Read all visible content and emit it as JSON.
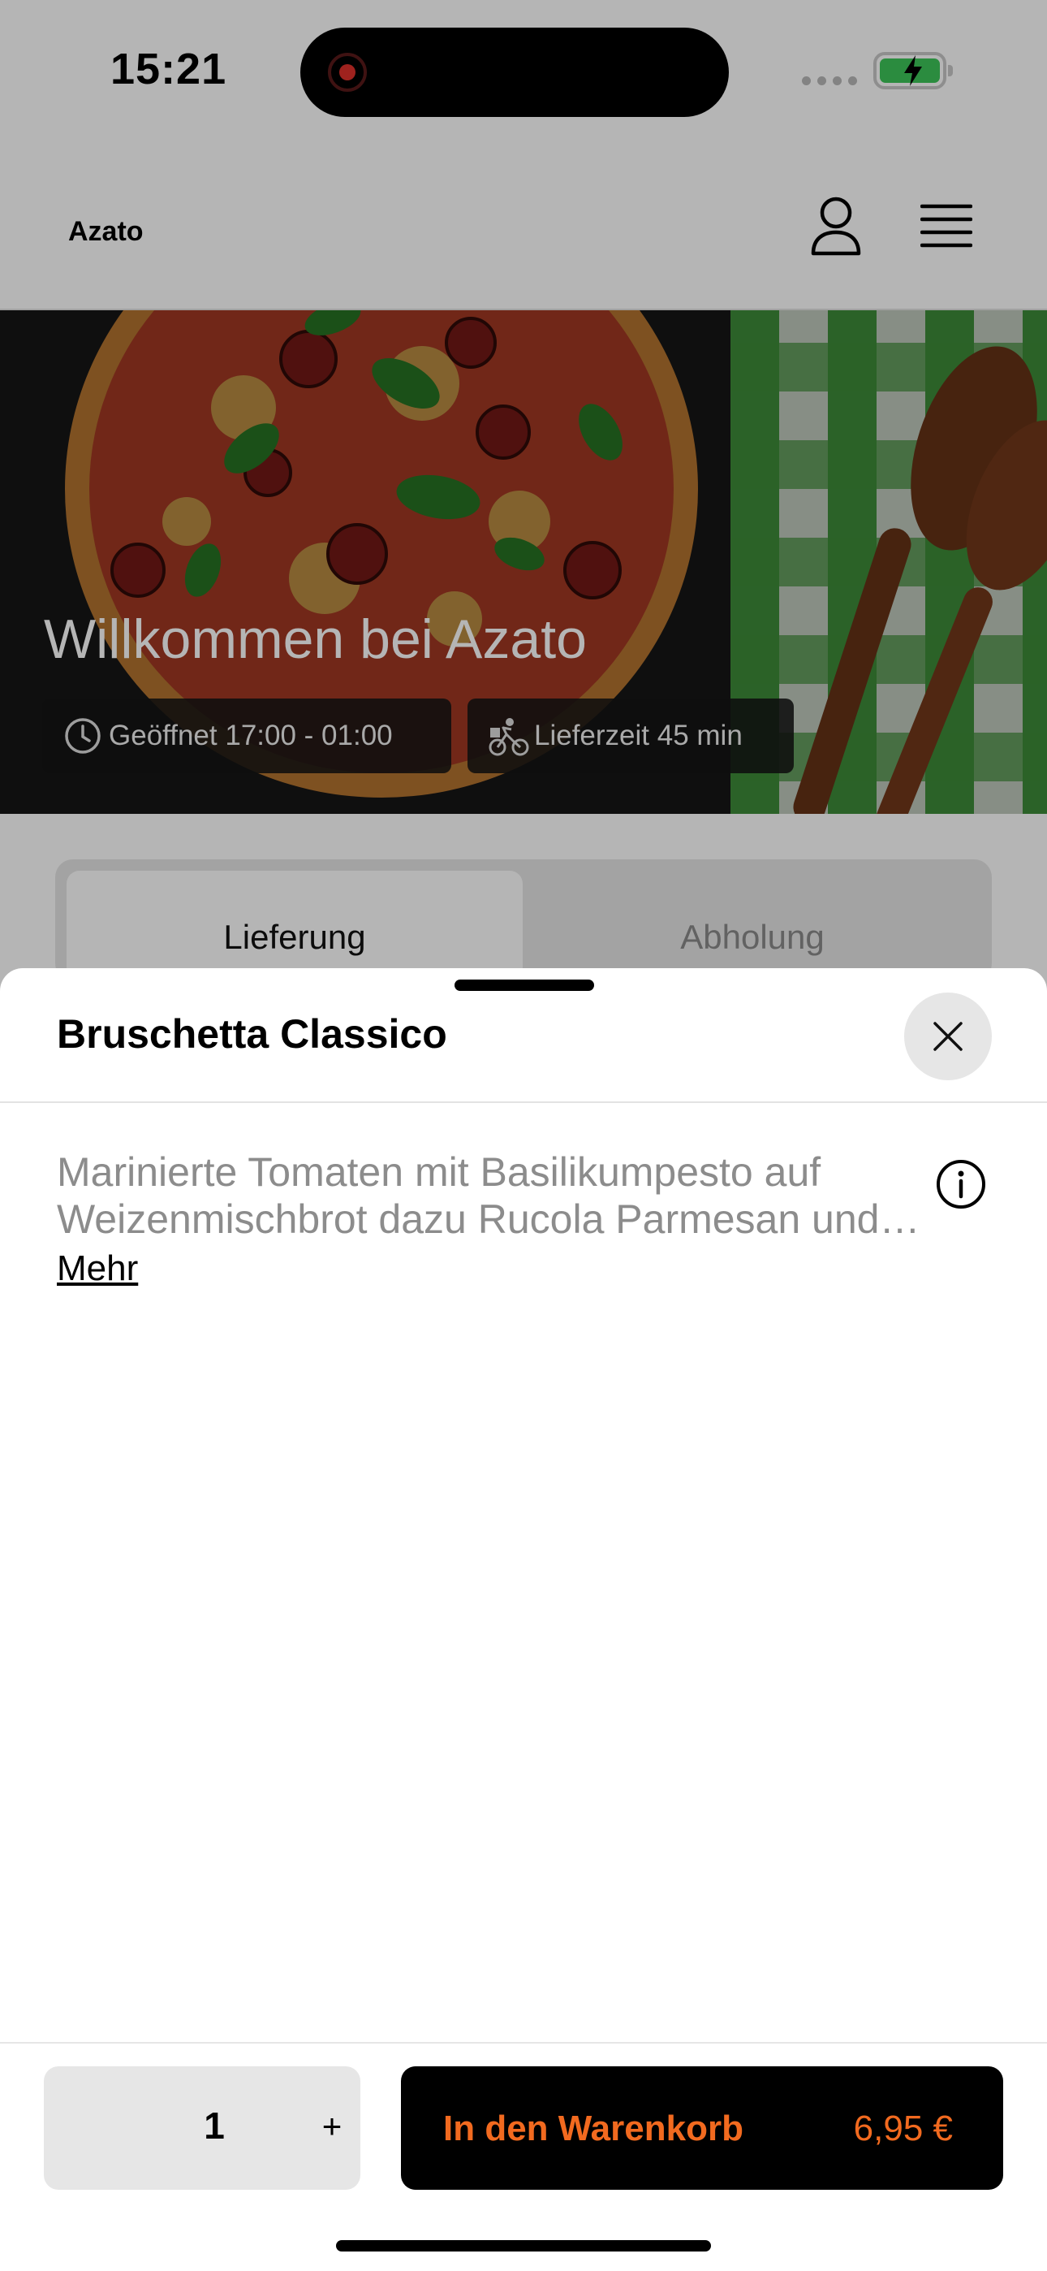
{
  "status_bar": {
    "time": "15:21"
  },
  "header": {
    "brand": "Azato",
    "icons": [
      "user-icon",
      "menu-icon"
    ]
  },
  "hero": {
    "title": "Willkommen bei Azato",
    "opening_hours": "Geöffnet 17:00 - 01:00",
    "delivery_time": "Lieferzeit 45 min"
  },
  "mode_tabs": {
    "delivery": "Lieferung",
    "pickup": "Abholung",
    "selected": "Lieferung"
  },
  "sheet": {
    "title": "Bruschetta Classico",
    "description": "Marinierte Tomaten mit Basilikumpesto auf Weizenmischbrot dazu Rucola Parmesan und…",
    "more_label": "Mehr"
  },
  "footer": {
    "quantity": "1",
    "plus_label": "+",
    "add_to_cart_label": "In den Warenkorb",
    "price": "6,95 €"
  },
  "colors": {
    "accent": "#f26a1f",
    "battery": "#3dc65a",
    "record": "#e0312b"
  }
}
